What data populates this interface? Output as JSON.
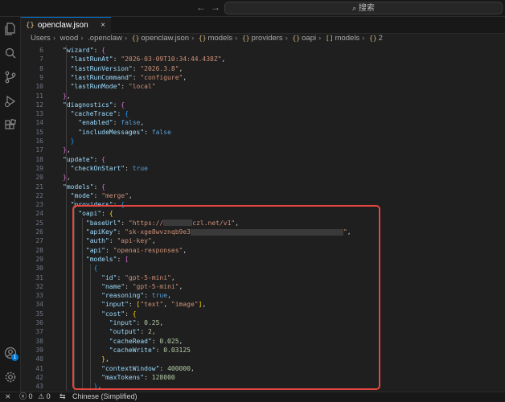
{
  "search": {
    "label": "搜索"
  },
  "tab": {
    "filename": "openclaw.json"
  },
  "breadcrumb": [
    "Users",
    "wood",
    ".openclaw",
    "openclaw.json",
    "models",
    "providers",
    "oapi",
    "models",
    "2"
  ],
  "code_lines": [
    {
      "n": "6",
      "html": "<span class='k'>\"wizard\"</span>: <span class='p2'>{</span>"
    },
    {
      "n": "7",
      "html": "  <span class='k'>\"lastRunAt\"</span>: <span class='s'>\"2026-03-09T10:34:44.438Z\"</span>,"
    },
    {
      "n": "8",
      "html": "  <span class='k'>\"lastRunVersion\"</span>: <span class='s'>\"2026.3.8\"</span>,"
    },
    {
      "n": "9",
      "html": "  <span class='k'>\"lastRunCommand\"</span>: <span class='s'>\"configure\"</span>,"
    },
    {
      "n": "10",
      "html": "  <span class='k'>\"lastRunMode\"</span>: <span class='s'>\"local\"</span>"
    },
    {
      "n": "11",
      "html": "<span class='p2'>}</span>,"
    },
    {
      "n": "12",
      "html": "<span class='k'>\"diagnostics\"</span>: <span class='p2'>{</span>"
    },
    {
      "n": "13",
      "html": "  <span class='k'>\"cacheTrace\"</span>: <span class='p3'>{</span>"
    },
    {
      "n": "14",
      "html": "    <span class='k'>\"enabled\"</span>: <span class='b1'>false</span>,"
    },
    {
      "n": "15",
      "html": "    <span class='k'>\"includeMessages\"</span>: <span class='b1'>false</span>"
    },
    {
      "n": "16",
      "html": "  <span class='p3'>}</span>"
    },
    {
      "n": "17",
      "html": "<span class='p2'>}</span>,"
    },
    {
      "n": "18",
      "html": "<span class='k'>\"update\"</span>: <span class='p2'>{</span>"
    },
    {
      "n": "19",
      "html": "  <span class='k'>\"checkOnStart\"</span>: <span class='b1'>true</span>"
    },
    {
      "n": "20",
      "html": "<span class='p2'>}</span>,"
    },
    {
      "n": "21",
      "html": "<span class='k'>\"models\"</span>: <span class='p2'>{</span>"
    },
    {
      "n": "22",
      "html": "  <span class='k'>\"mode\"</span>: <span class='s'>\"merge\"</span>,"
    },
    {
      "n": "23",
      "html": "  <span class='k'>\"providers\"</span>: <span class='p3'>{</span>"
    },
    {
      "n": "24",
      "html": "    <span class='k'>\"oapi\"</span>: <span class='p1'>{</span>"
    },
    {
      "n": "25",
      "html": "      <span class='k'>\"baseUrl\"</span>: <span class='s'>\"https://<span class='redact' style='width:36px'></span>czl.net/v1\"</span>,"
    },
    {
      "n": "26",
      "html": "      <span class='k'>\"apiKey\"</span>: <span class='s'>\"sk-xge8wvznqb9e3<span class='redact' style='width:190px'></span>\"</span>,"
    },
    {
      "n": "27",
      "html": "      <span class='k'>\"auth\"</span>: <span class='s'>\"api-key\"</span>,"
    },
    {
      "n": "28",
      "html": "      <span class='k'>\"api\"</span>: <span class='s'>\"openai-responses\"</span>,"
    },
    {
      "n": "29",
      "html": "      <span class='k'>\"models\"</span>: <span class='p2'>[</span>"
    },
    {
      "n": "30",
      "html": "        <span class='p3'>{</span>"
    },
    {
      "n": "31",
      "html": "          <span class='k'>\"id\"</span>: <span class='s'>\"gpt-5-mini\"</span>,"
    },
    {
      "n": "32",
      "html": "          <span class='k'>\"name\"</span>: <span class='s'>\"gpt-5-mini\"</span>,"
    },
    {
      "n": "33",
      "html": "          <span class='k'>\"reasoning\"</span>: <span class='b1'>true</span>,"
    },
    {
      "n": "34",
      "html": "          <span class='k'>\"input\"</span>: <span class='p1'>[</span><span class='s'>\"text\"</span>, <span class='s'>\"image\"</span><span class='p1'>]</span>,"
    },
    {
      "n": "35",
      "html": "          <span class='k'>\"cost\"</span>: <span class='p1'>{</span>"
    },
    {
      "n": "36",
      "html": "            <span class='k'>\"input\"</span>: <span class='n'>0.25</span>,"
    },
    {
      "n": "37",
      "html": "            <span class='k'>\"output\"</span>: <span class='n'>2</span>,"
    },
    {
      "n": "38",
      "html": "            <span class='k'>\"cacheRead\"</span>: <span class='n'>0.025</span>,"
    },
    {
      "n": "39",
      "html": "            <span class='k'>\"cacheWrite\"</span>: <span class='n'>0.03125</span>"
    },
    {
      "n": "40",
      "html": "          <span class='p1'>}</span>,"
    },
    {
      "n": "41",
      "html": "          <span class='k'>\"contextWindow\"</span>: <span class='n'>400000</span>,"
    },
    {
      "n": "42",
      "html": "          <span class='k'>\"maxTokens\"</span>: <span class='n'>128000</span>"
    },
    {
      "n": "43",
      "html": "        <span class='p3'>}</span>,"
    }
  ],
  "status": {
    "errors": "0",
    "warnings": "0",
    "language": "Chinese (Simplified)"
  },
  "account_badge": "1"
}
